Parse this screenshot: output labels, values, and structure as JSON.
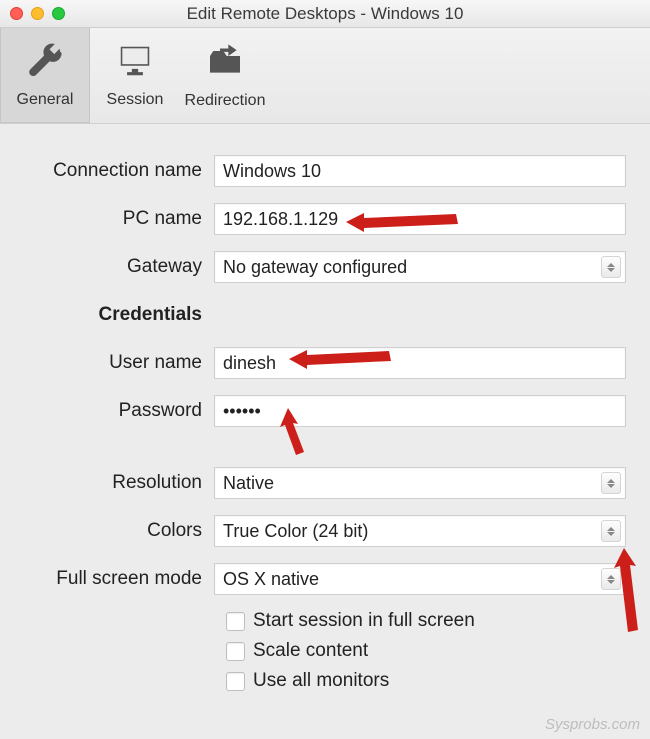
{
  "window": {
    "title": "Edit Remote Desktops - Windows 10"
  },
  "toolbar": {
    "general": "General",
    "session": "Session",
    "redirection": "Redirection"
  },
  "labels": {
    "connection_name": "Connection name",
    "pc_name": "PC name",
    "gateway": "Gateway",
    "credentials": "Credentials",
    "user_name": "User name",
    "password": "Password",
    "resolution": "Resolution",
    "colors": "Colors",
    "full_screen_mode": "Full screen mode"
  },
  "fields": {
    "connection_name": "Windows 10",
    "pc_name": "192.168.1.129",
    "gateway": "No gateway configured",
    "user_name": "dinesh",
    "password": "••••••",
    "resolution": "Native",
    "colors": "True Color (24 bit)",
    "full_screen_mode": "OS X native"
  },
  "checks": {
    "start_full_screen": "Start session in full screen",
    "scale_content": "Scale content",
    "use_all_monitors": "Use all monitors"
  },
  "watermark": "Sysprobs.com"
}
